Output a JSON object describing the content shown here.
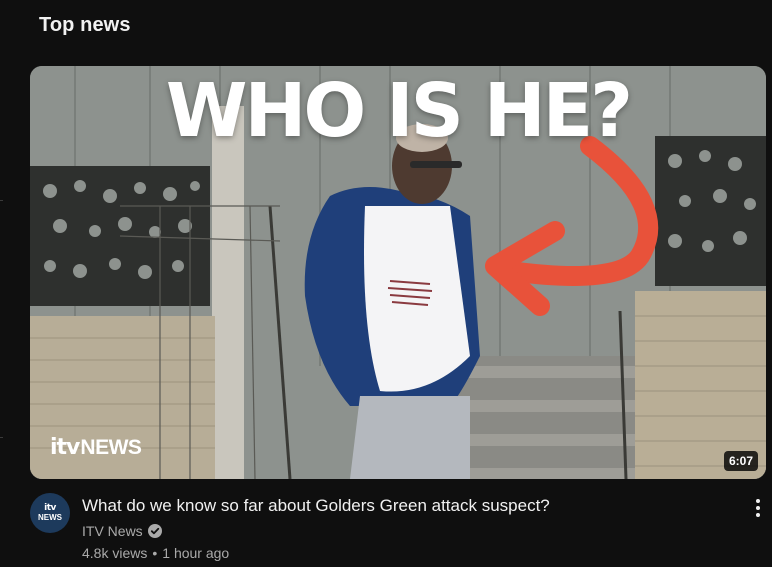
{
  "shelf": {
    "title": "Top news"
  },
  "video": {
    "thumbnail_headline": "WHO IS HE?",
    "logo": {
      "itv": "itv",
      "news": "NEWS"
    },
    "duration": "6:07",
    "title": "What do we know so far about Golders Green attack suspect?",
    "channel": "ITV News",
    "channel_avatar": {
      "line1": "itv",
      "line2": "NEWS"
    },
    "verified": true,
    "views": "4.8k views",
    "separator": "•",
    "published": "1 hour ago"
  },
  "icons": [
    "verified-icon",
    "more-vert-icon"
  ],
  "colors": {
    "background": "#0f0f0f",
    "text_primary": "#f1f1f1",
    "text_secondary": "#aaaaaa",
    "arrow": "#e8523a"
  }
}
